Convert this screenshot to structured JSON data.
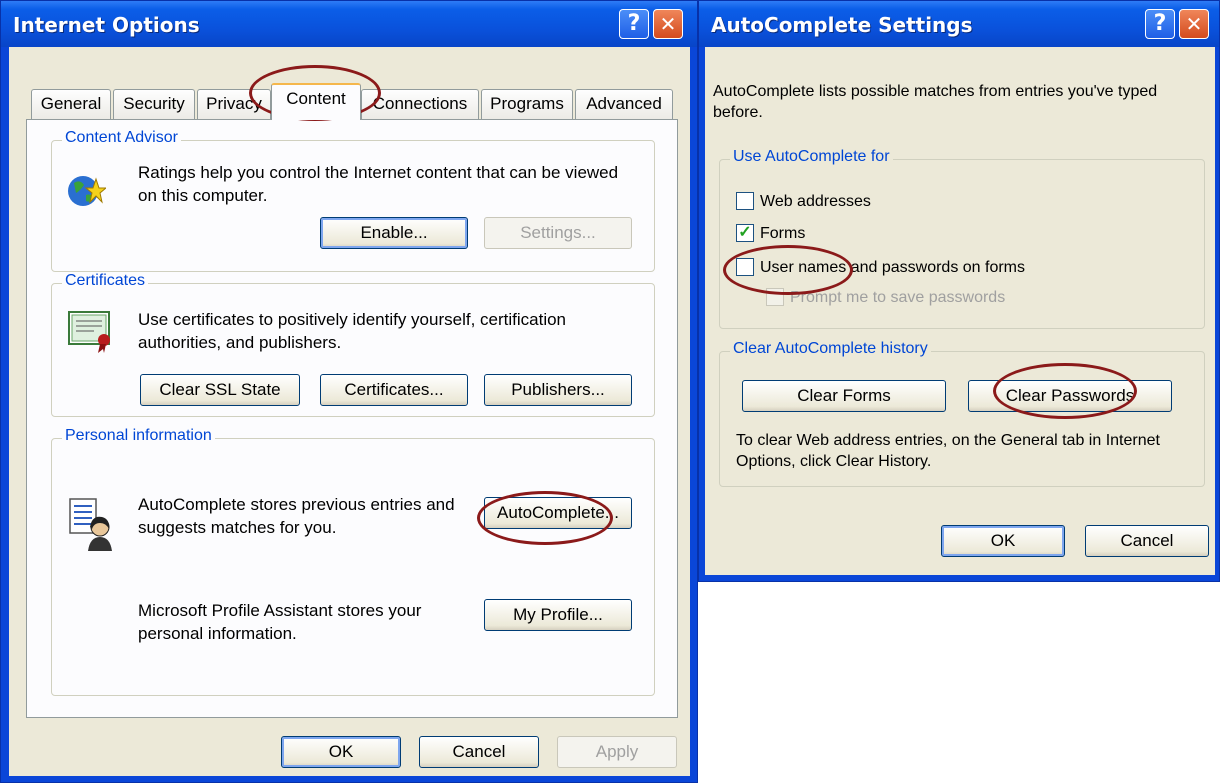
{
  "internet_options": {
    "title": "Internet Options",
    "help_glyph": "?",
    "close_glyph": "✕",
    "tabs": [
      "General",
      "Security",
      "Privacy",
      "Content",
      "Connections",
      "Programs",
      "Advanced"
    ],
    "active_tab": "Content",
    "content_advisor": {
      "label": "Content Advisor",
      "text": "Ratings help you control the Internet content that can be viewed on this computer.",
      "enable_button": "Enable...",
      "settings_button": "Settings..."
    },
    "certificates": {
      "label": "Certificates",
      "text": "Use certificates to positively identify yourself, certification authorities, and publishers.",
      "clear_ssl_button": "Clear SSL State",
      "certificates_button": "Certificates...",
      "publishers_button": "Publishers..."
    },
    "personal_information": {
      "label": "Personal information",
      "autocomplete_text": "AutoComplete stores previous entries and suggests matches for you.",
      "autocomplete_button": "AutoComplete...",
      "profile_text": "Microsoft Profile Assistant stores your personal information.",
      "profile_button": "My Profile..."
    },
    "ok_button": "OK",
    "cancel_button": "Cancel",
    "apply_button": "Apply"
  },
  "autocomplete_settings": {
    "title": "AutoComplete Settings",
    "help_glyph": "?",
    "close_glyph": "✕",
    "intro": "AutoComplete lists possible matches from entries you've typed before.",
    "use_for": {
      "label": "Use AutoComplete for",
      "options": [
        {
          "label": "Web addresses",
          "checked": false,
          "enabled": true
        },
        {
          "label": "Forms",
          "checked": true,
          "enabled": true
        },
        {
          "label": "User names and passwords on forms",
          "checked": false,
          "enabled": true
        },
        {
          "label": "Prompt me to save passwords",
          "checked": false,
          "enabled": false
        }
      ]
    },
    "clear_history": {
      "label": "Clear AutoComplete history",
      "clear_forms_button": "Clear Forms",
      "clear_passwords_button": "Clear Passwords",
      "note": "To clear Web address entries, on the General tab in Internet Options, click Clear History."
    },
    "ok_button": "OK",
    "cancel_button": "Cancel"
  },
  "colors": {
    "titlebar": "#0a52dc",
    "dialog_face": "#ece9d8",
    "group_label": "#0046d5",
    "annotation": "#8b1a1a"
  }
}
